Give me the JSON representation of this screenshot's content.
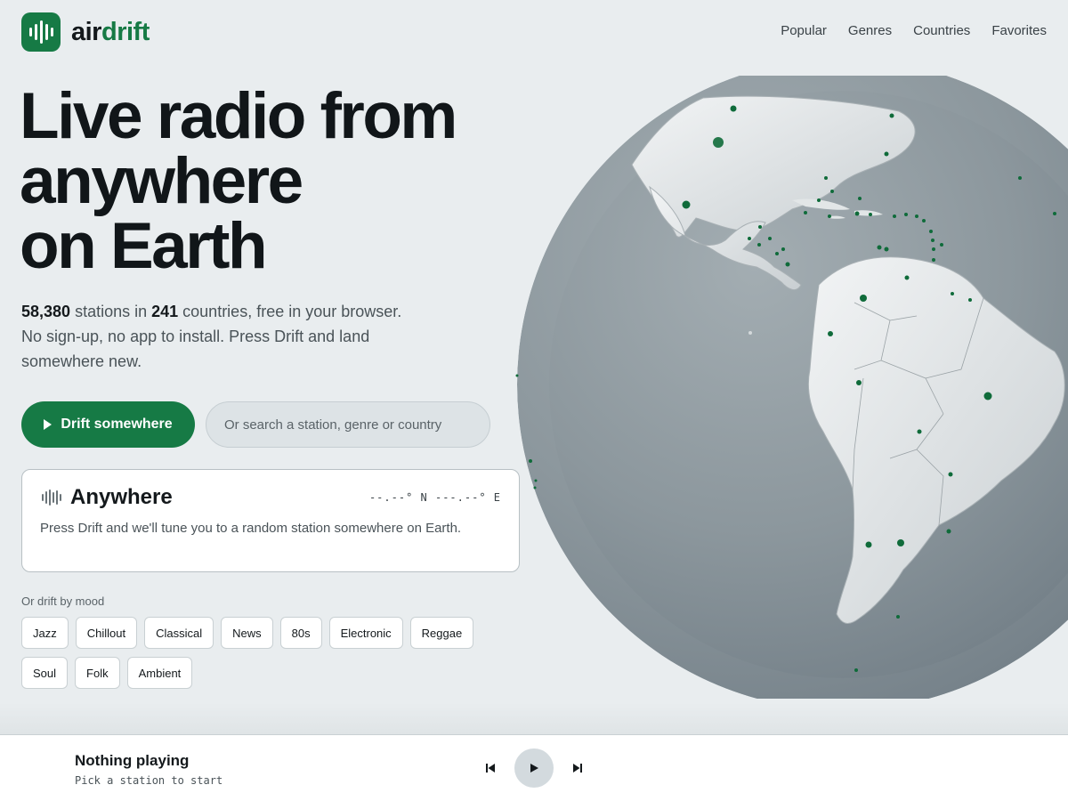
{
  "header": {
    "brand_a": "air",
    "brand_b": "drift",
    "nav": [
      "Popular",
      "Genres",
      "Countries",
      "Favorites"
    ]
  },
  "hero": {
    "headline": [
      "Live radio from",
      "anywhere",
      "on Earth"
    ],
    "stations_count": "58,380",
    "stations_text": " stations in ",
    "countries_count": "241",
    "countries_text": " countries, free in your browser.",
    "sub_line2": "No sign-up, no app to install. Press Drift and land somewhere new.",
    "drift_button": "Drift somewhere",
    "search_placeholder": "Or search a station, genre or country"
  },
  "card": {
    "title": "Anywhere",
    "coords": "--.--° N  ---.--° E",
    "description": "Press Drift and we'll tune you to a random station somewhere on Earth."
  },
  "mood": {
    "label": "Or drift by mood",
    "chips": [
      "Jazz",
      "Chillout",
      "Classical",
      "News",
      "80s",
      "Electronic",
      "Reggae",
      "Soul",
      "Folk",
      "Ambient"
    ]
  },
  "player": {
    "title": "Nothing playing",
    "subtitle": "Pick a station to start"
  },
  "colors": {
    "brand": "#167a45",
    "background": "#e9edef",
    "ocean": "#8e999f",
    "land": "#e2e6e7",
    "station_dot": "#0f6b3a"
  },
  "icons": [
    "logo-waveform-icon",
    "play-icon",
    "waveform-icon",
    "globe-map",
    "previous-icon",
    "next-icon"
  ]
}
